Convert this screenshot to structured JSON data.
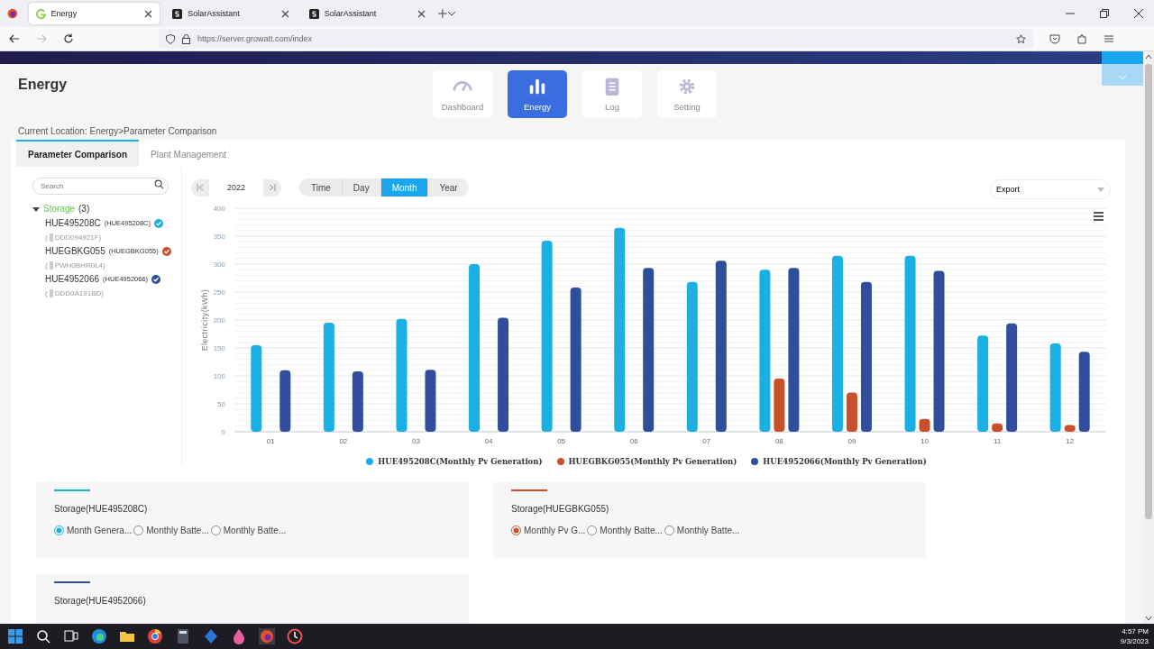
{
  "browser": {
    "tabs": [
      {
        "title": "Energy",
        "selected": true,
        "kind": "growatt"
      },
      {
        "title": "SolarAssistant",
        "selected": false,
        "kind": "solar"
      },
      {
        "title": "SolarAssistant",
        "selected": false,
        "kind": "solar"
      }
    ],
    "url_host": "https://server.growatt.com/index"
  },
  "page": {
    "title": "Energy",
    "nav": [
      {
        "label": "Dashboard",
        "kind": "gauge",
        "selected": false
      },
      {
        "label": "Energy",
        "kind": "chart",
        "selected": true
      },
      {
        "label": "Log",
        "kind": "log",
        "selected": false
      },
      {
        "label": "Setting",
        "kind": "gear",
        "selected": false
      }
    ],
    "breadcrumb": "Current Location: Energy>Parameter Comparison",
    "subtabs": [
      {
        "label": "Parameter Comparison",
        "selected": true
      },
      {
        "label": "Plant Management",
        "selected": false
      }
    ],
    "search": {
      "placeholder": "Search"
    },
    "tree": {
      "label": "Storage",
      "count": "(3)",
      "expanded": true,
      "children": [
        {
          "name": "HUE495208C",
          "sn": "(HUE495208C)",
          "prefix": "(",
          "device": "DDD094921F)",
          "color": "#1ab0e4",
          "checked": true
        },
        {
          "name": "HUEGBKG055",
          "sn": "(HUEGBKG055)",
          "prefix": "(",
          "device": "PWH0BHR0L4)",
          "color": "#c8502a",
          "checked": true
        },
        {
          "name": "HUE4952066",
          "sn": "(HUE4952066)",
          "prefix": "(",
          "device": "DDD0A191BD)",
          "color": "#2f4f9c",
          "checked": true
        }
      ]
    },
    "year": "2022",
    "periods": [
      {
        "label": "Time",
        "selected": false
      },
      {
        "label": "Day",
        "selected": false
      },
      {
        "label": "Month",
        "selected": true
      },
      {
        "label": "Year",
        "selected": false
      }
    ],
    "export": "Export",
    "chart_data": {
      "type": "bar",
      "ylabel": "Electricity(kWh)",
      "categories": [
        "01",
        "02",
        "03",
        "04",
        "05",
        "06",
        "07",
        "08",
        "09",
        "10",
        "11",
        "12"
      ],
      "grid": true,
      "legend": "bottom",
      "ylim": [
        0,
        400
      ],
      "yticks": [
        0,
        50,
        100,
        150,
        200,
        250,
        300,
        350,
        400
      ],
      "series": [
        {
          "name": "HUE495208C(Monthly Pv Generation)",
          "color": "#1ab0e4",
          "values": [
            155,
            195,
            202,
            300,
            342,
            365,
            268,
            290,
            315,
            315,
            172,
            158
          ]
        },
        {
          "name": "HUEGBKG055(Monthly Pv Generation)",
          "color": "#c8502a",
          "values": [
            null,
            null,
            null,
            null,
            null,
            null,
            null,
            95,
            70,
            23,
            15,
            12
          ]
        },
        {
          "name": "HUE4952066(Monthly Pv Generation)",
          "color": "#2f4f9c",
          "values": [
            110,
            108,
            111,
            204,
            258,
            293,
            306,
            293,
            268,
            288,
            194,
            143
          ]
        }
      ]
    },
    "cards": [
      {
        "title": "Storage(HUE495208C)",
        "color": "#1ab0e4",
        "options": [
          {
            "label": "Month Genera...",
            "selected": true
          },
          {
            "label": "Monthly Batte...",
            "selected": false
          },
          {
            "label": "Monthly Batte...",
            "selected": false
          }
        ]
      },
      {
        "title": "Storage(HUEGBKG055)",
        "color": "#c8502a",
        "options": [
          {
            "label": "Monthly Pv G...",
            "selected": true
          },
          {
            "label": "Monthly Batte...",
            "selected": false
          },
          {
            "label": "Monthly Batte...",
            "selected": false
          }
        ]
      },
      {
        "title": "Storage(HUE4952066)",
        "color": "#2f4f9c"
      }
    ]
  },
  "taskbar": {
    "time": "4:57 PM",
    "date": "9/3/2023"
  }
}
